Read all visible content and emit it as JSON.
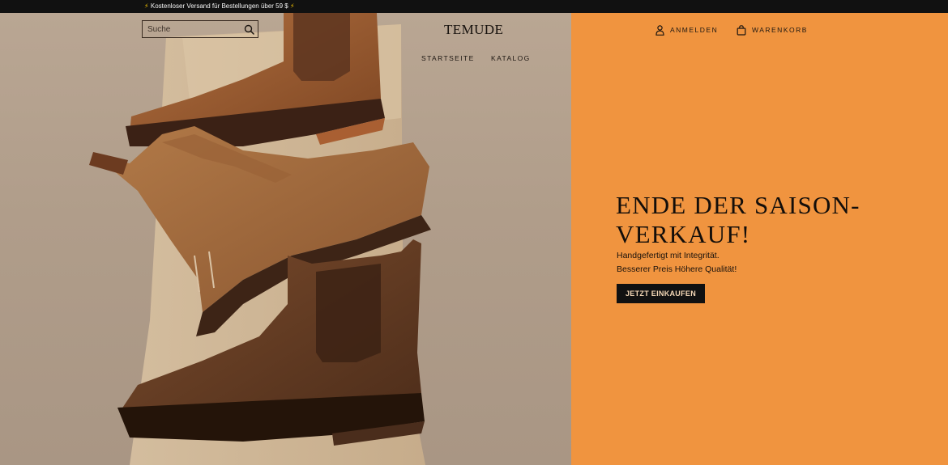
{
  "announcement": {
    "bolt_glyph": "⚡",
    "text": "Kostenloser Versand für Bestellungen über 59 $"
  },
  "header": {
    "search": {
      "placeholder": "Suche",
      "value": ""
    },
    "logo": "TEMUDE",
    "nav": [
      {
        "label": "STARTSEITE"
      },
      {
        "label": "KATALOG"
      }
    ],
    "account_label": "ANMELDEN",
    "cart_label": "WARENKORB"
  },
  "hero": {
    "image_alt": "Drei braune Lederstiefel auf einem Holzblock",
    "title": "ENDE DER SAISON-VERKAUF!",
    "subtitle_line1": "Handgefertigt mit Integrität.",
    "subtitle_line2": "Besserer Preis Höhere Qualität!",
    "cta_label": "JETZT EINKAUFEN"
  },
  "colors": {
    "announcement_bg": "#111111",
    "panel_bg": "#f0943f",
    "cta_bg": "#111111",
    "cta_text": "#f3d7b6",
    "bolt": "#f5c400"
  },
  "icons": {
    "search": "search-icon",
    "account": "user-icon",
    "cart": "shopping-bag-icon",
    "bolt": "lightning-bolt-icon"
  }
}
